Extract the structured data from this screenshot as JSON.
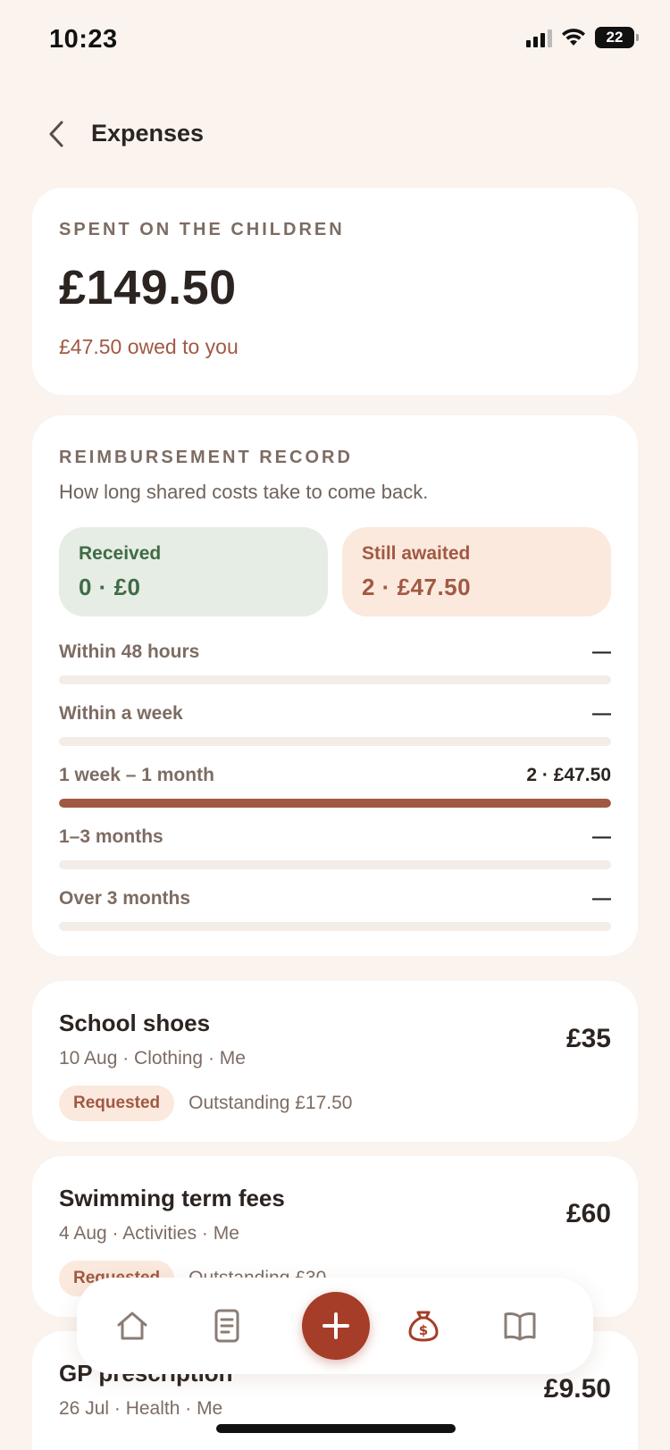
{
  "status_bar": {
    "time": "10:23",
    "battery": "22"
  },
  "header": {
    "title": "Expenses",
    "back_icon": "chevron-left-icon"
  },
  "summary": {
    "eyebrow": "SPENT ON THE CHILDREN",
    "amount": "£149.50",
    "owed": "£47.50 owed to you"
  },
  "reimbursement": {
    "eyebrow": "REIMBURSEMENT RECORD",
    "subtitle": "How long shared costs take to come back.",
    "received": {
      "label": "Received",
      "value": "0 · £0"
    },
    "awaited": {
      "label": "Still awaited",
      "value": "2 · £47.50"
    },
    "buckets": [
      {
        "label": "Within 48 hours",
        "value": "—",
        "fill_fraction": 0
      },
      {
        "label": "Within a week",
        "value": "—",
        "fill_fraction": 0
      },
      {
        "label": "1 week – 1 month",
        "value": "2 · £47.50",
        "fill_fraction": 1
      },
      {
        "label": "1–3 months",
        "value": "—",
        "fill_fraction": 0
      },
      {
        "label": "Over 3 months",
        "value": "—",
        "fill_fraction": 0
      }
    ]
  },
  "expenses": [
    {
      "title": "School shoes",
      "meta": "10 Aug · Clothing · Me",
      "amount": "£35",
      "status": "Requested",
      "outstanding": "Outstanding £17.50"
    },
    {
      "title": "Swimming term fees",
      "meta": "4 Aug · Activities · Me",
      "amount": "£60",
      "status": "Requested",
      "outstanding": "Outstanding £30"
    },
    {
      "title": "GP prescription",
      "meta": "26 Jul · Health · Me",
      "amount": "£9.50"
    }
  ],
  "nav": {
    "items": [
      "home-icon",
      "document-icon",
      "plus-icon",
      "money-bag-icon",
      "book-icon"
    ],
    "active": "money-bag-icon",
    "colors": {
      "accent": "#a53d28",
      "inactive": "#8a7d76"
    }
  },
  "colors": {
    "background": "#faf3ee",
    "accent": "#a15943",
    "positive": "#3f6b45"
  }
}
